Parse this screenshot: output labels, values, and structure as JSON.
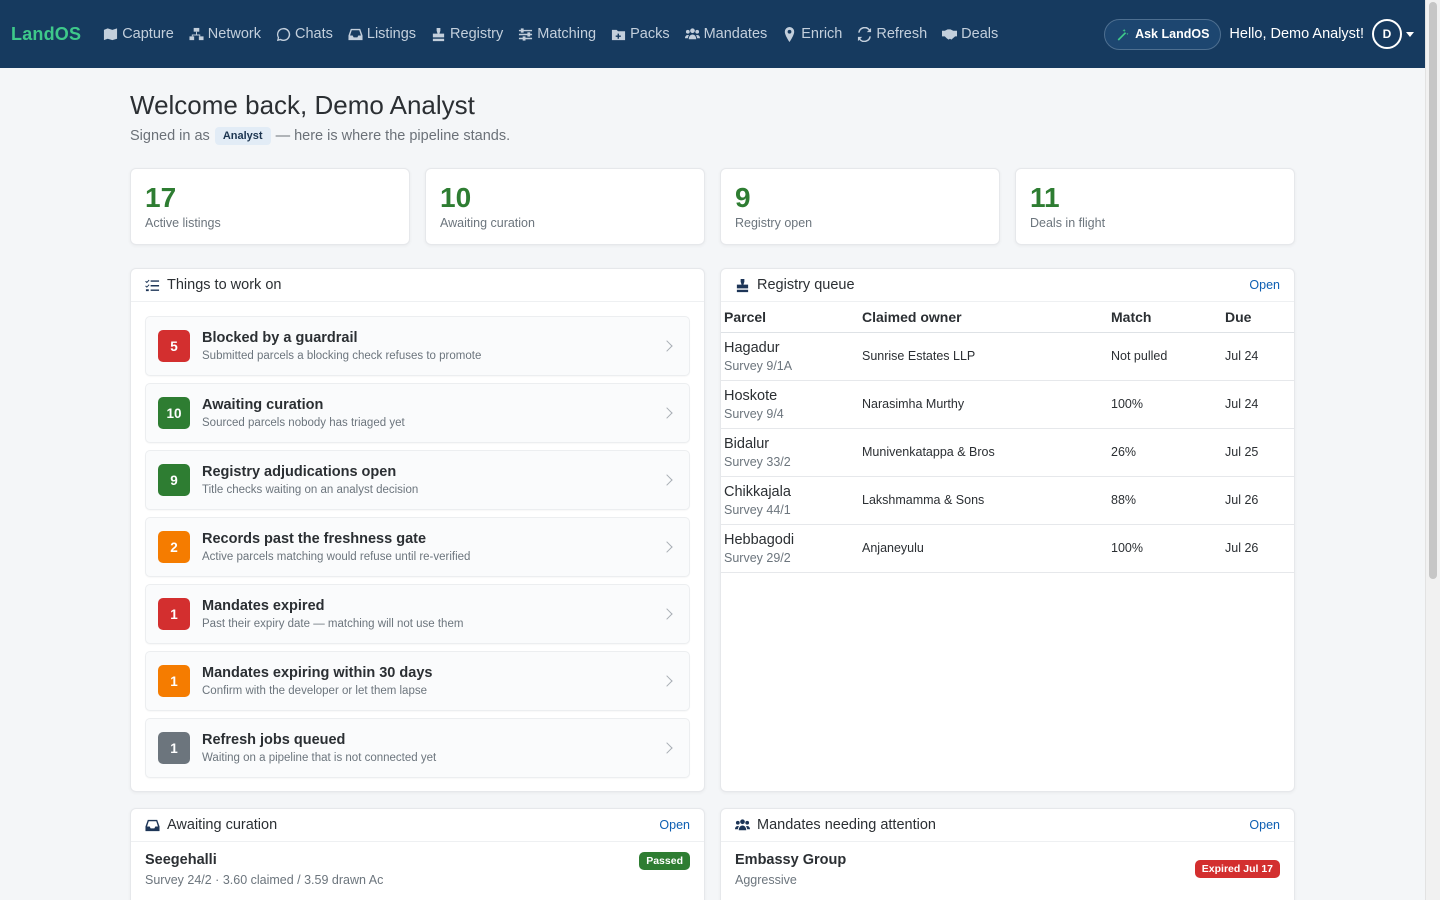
{
  "nav": {
    "brand": "LandOS",
    "items": [
      {
        "label": "Capture",
        "icon": "capture-icon"
      },
      {
        "label": "Network",
        "icon": "network-icon"
      },
      {
        "label": "Chats",
        "icon": "chat-icon"
      },
      {
        "label": "Listings",
        "icon": "inbox-icon"
      },
      {
        "label": "Registry",
        "icon": "stamp-icon"
      },
      {
        "label": "Matching",
        "icon": "sliders-icon"
      },
      {
        "label": "Packs",
        "icon": "folder-plus-icon"
      },
      {
        "label": "Mandates",
        "icon": "users-icon"
      },
      {
        "label": "Enrich",
        "icon": "map-pin-icon"
      },
      {
        "label": "Refresh",
        "icon": "refresh-icon"
      },
      {
        "label": "Deals",
        "icon": "handshake-icon"
      }
    ],
    "ask_label": "Ask LandOS",
    "greeting": "Hello, Demo Analyst!",
    "avatar_initial": "D"
  },
  "header": {
    "title": "Welcome back, Demo Analyst",
    "signed_prefix": "Signed in as",
    "role": "Analyst",
    "signed_suffix": "— here is where the pipeline stands."
  },
  "stats": [
    {
      "value": "17",
      "label": "Active listings"
    },
    {
      "value": "10",
      "label": "Awaiting curation"
    },
    {
      "value": "9",
      "label": "Registry open"
    },
    {
      "value": "11",
      "label": "Deals in flight"
    }
  ],
  "work": {
    "title": "Things to work on",
    "items": [
      {
        "count": "5",
        "color": "#d32f2f",
        "title": "Blocked by a guardrail",
        "desc": "Submitted parcels a blocking check refuses to promote"
      },
      {
        "count": "10",
        "color": "#2e7d32",
        "title": "Awaiting curation",
        "desc": "Sourced parcels nobody has triaged yet"
      },
      {
        "count": "9",
        "color": "#2e7d32",
        "title": "Registry adjudications open",
        "desc": "Title checks waiting on an analyst decision"
      },
      {
        "count": "2",
        "color": "#f57c00",
        "title": "Records past the freshness gate",
        "desc": "Active parcels matching would refuse until re-verified"
      },
      {
        "count": "1",
        "color": "#d32f2f",
        "title": "Mandates expired",
        "desc": "Past their expiry date — matching will not use them"
      },
      {
        "count": "1",
        "color": "#f57c00",
        "title": "Mandates expiring within 30 days",
        "desc": "Confirm with the developer or let them lapse"
      },
      {
        "count": "1",
        "color": "#6c757d",
        "title": "Refresh jobs queued",
        "desc": "Waiting on a pipeline that is not connected yet"
      }
    ]
  },
  "registry": {
    "title": "Registry queue",
    "link": "Open",
    "columns": [
      "Parcel",
      "Claimed owner",
      "Match",
      "Due"
    ],
    "rows": [
      {
        "parcel": "Hagadur",
        "survey": "Survey 9/1A",
        "owner": "Sunrise Estates LLP",
        "match": "Not pulled",
        "due": "Jul 24"
      },
      {
        "parcel": "Hoskote",
        "survey": "Survey 9/4",
        "owner": "Narasimha Murthy",
        "match": "100%",
        "due": "Jul 24"
      },
      {
        "parcel": "Bidalur",
        "survey": "Survey 33/2",
        "owner": "Munivenkatappa & Bros",
        "match": "26%",
        "due": "Jul 25"
      },
      {
        "parcel": "Chikkajala",
        "survey": "Survey 44/1",
        "owner": "Lakshmamma & Sons",
        "match": "88%",
        "due": "Jul 26"
      },
      {
        "parcel": "Hebbagodi",
        "survey": "Survey 29/2",
        "owner": "Anjaneyulu",
        "match": "100%",
        "due": "Jul 26"
      }
    ]
  },
  "curation": {
    "title": "Awaiting curation",
    "link": "Open",
    "rows": [
      {
        "name": "Seegehalli",
        "detail": "Survey 24/2 · 3.60 claimed / 3.59 drawn Ac",
        "status": "Passed",
        "status_color": "#2e7d32"
      }
    ]
  },
  "mandates": {
    "title": "Mandates needing attention",
    "link": "Open",
    "rows": [
      {
        "name": "Embassy Group",
        "detail": "Aggressive",
        "status": "Expired Jul 17",
        "status_color": "#d32f2f"
      }
    ]
  }
}
